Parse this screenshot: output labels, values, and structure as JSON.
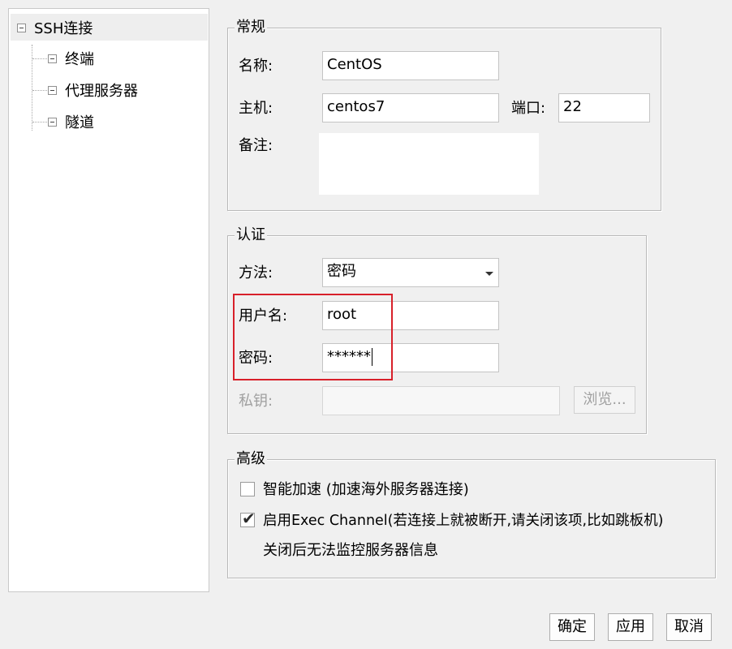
{
  "tree": {
    "root": "SSH连接",
    "children": [
      "终端",
      "代理服务器",
      "隧道"
    ]
  },
  "general": {
    "legend": "常规",
    "name_label": "名称:",
    "name_value": "CentOS",
    "host_label": "主机:",
    "host_value": "centos7",
    "port_label": "端口:",
    "port_value": "22",
    "notes_label": "备注:",
    "notes_value": ""
  },
  "auth": {
    "legend": "认证",
    "method_label": "方法:",
    "method_value": "密码",
    "username_label": "用户名:",
    "username_value": "root",
    "password_label": "密码:",
    "password_value": "******",
    "privatekey_label": "私钥:",
    "privatekey_value": "",
    "browse_label": "浏览..."
  },
  "advanced": {
    "legend": "高级",
    "accelerate_label": "智能加速 (加速海外服务器连接)",
    "accelerate_checked": false,
    "exec_channel_label": "启用Exec Channel(若连接上就被断开,请关闭该项,比如跳板机)",
    "exec_channel_checked": true,
    "exec_channel_note": "关闭后无法监控服务器信息"
  },
  "buttons": {
    "ok": "确定",
    "apply": "应用",
    "cancel": "取消"
  },
  "colors": {
    "highlight": "#d8202a",
    "background": "#f0f0f0"
  }
}
